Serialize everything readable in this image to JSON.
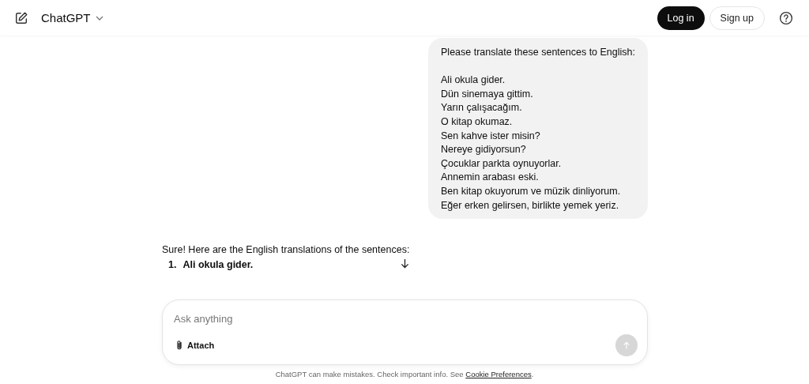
{
  "header": {
    "title": "ChatGPT",
    "buttons": [
      {
        "label": "Log in",
        "kind": "primary"
      },
      {
        "label": "Sign up",
        "kind": "secondary"
      }
    ]
  },
  "user_message": {
    "intro": "Please translate these sentences to English:",
    "lines": [
      "Ali okula gider.",
      "Dün sinemaya gittim.",
      "Yarın çalışacağım.",
      "O kitap okumaz.",
      "Sen kahve ister misin?",
      "Nereye gidiyorsun?",
      "Çocuklar parkta oynuyorlar.",
      "Annemin arabası eski.",
      "Ben kitap okuyorum ve müzik dinliyorum.",
      "Eğer erken gelirsen, birlikte yemek yeriz."
    ]
  },
  "assistant_message": {
    "intro": "Sure! Here are the English translations of the sentences:",
    "items": [
      {
        "number": "1.",
        "text": "Ali okula gider."
      }
    ]
  },
  "composer": {
    "placeholder": "Ask anything",
    "attach_label": "Attach",
    "send_disabled": true
  },
  "footer": {
    "text": "ChatGPT can make mistakes. Check important info. See ",
    "link": "Cookie Preferences",
    "end": "."
  }
}
